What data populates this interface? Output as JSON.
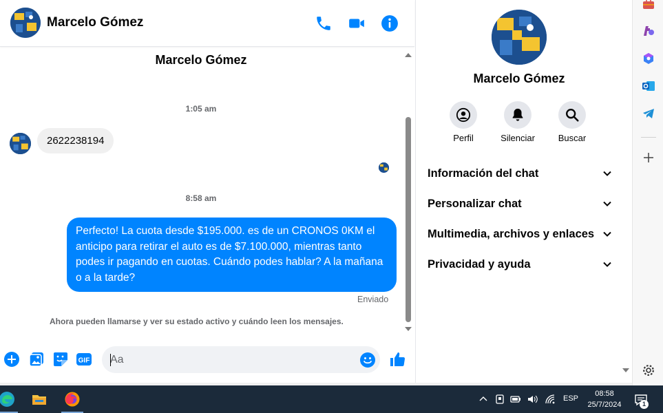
{
  "contact": {
    "name": "Marcelo Gómez"
  },
  "header": {
    "icons": [
      "phone-icon",
      "video-camera-icon",
      "info-icon"
    ]
  },
  "conversation": {
    "title": "Marcelo Gómez",
    "messages": [
      {
        "timestamp": "1:05 am",
        "direction": "incoming",
        "text": "2622238194"
      },
      {
        "timestamp": "8:58 am",
        "direction": "outgoing",
        "text": "Perfecto! La cuota desde $195.000. es de un CRONOS 0KM el anticipo para retirar el auto es de $7.100.000, mientras tanto podes ir pagando en cuotas. Cuándo podes hablar? A la mañana o a la tarde?",
        "status": "Enviado"
      }
    ],
    "notice": "Ahora pueden llamarse y ver su estado activo y cuándo leen los mensajes."
  },
  "composer": {
    "placeholder": "Aa",
    "icons": [
      "plus-circle-icon",
      "photo-gallery-icon",
      "sticker-icon",
      "gif-icon",
      "emoji-icon",
      "thumbs-up-icon"
    ],
    "gif_label": "GIF"
  },
  "info_panel": {
    "name": "Marcelo Gómez",
    "actions": [
      {
        "label": "Perfil",
        "icon": "profile-icon"
      },
      {
        "label": "Silenciar",
        "icon": "bell-icon"
      },
      {
        "label": "Buscar",
        "icon": "search-icon"
      }
    ],
    "sections": [
      {
        "label": "Información del chat"
      },
      {
        "label": "Personalizar chat"
      },
      {
        "label": "Multimedia, archivos y enlaces"
      },
      {
        "label": "Privacidad y ayuda"
      }
    ]
  },
  "colors": {
    "accent": "#0084ff",
    "bubble_in": "#f0f0f0",
    "taskbar": "#1b2a3a",
    "secondary_text": "#65676b"
  },
  "edge_sidebar": {
    "icons": [
      "toolbox-icon",
      "games-icon",
      "copilot-icon",
      "outlook-icon",
      "telegram-icon",
      "add-icon",
      "settings-icon"
    ]
  },
  "taskbar": {
    "apps": [
      "edge-icon",
      "file-explorer-icon",
      "firefox-icon"
    ],
    "language": "ESP",
    "time": "08:58",
    "date": "25/7/2024",
    "notification_count": "1"
  }
}
